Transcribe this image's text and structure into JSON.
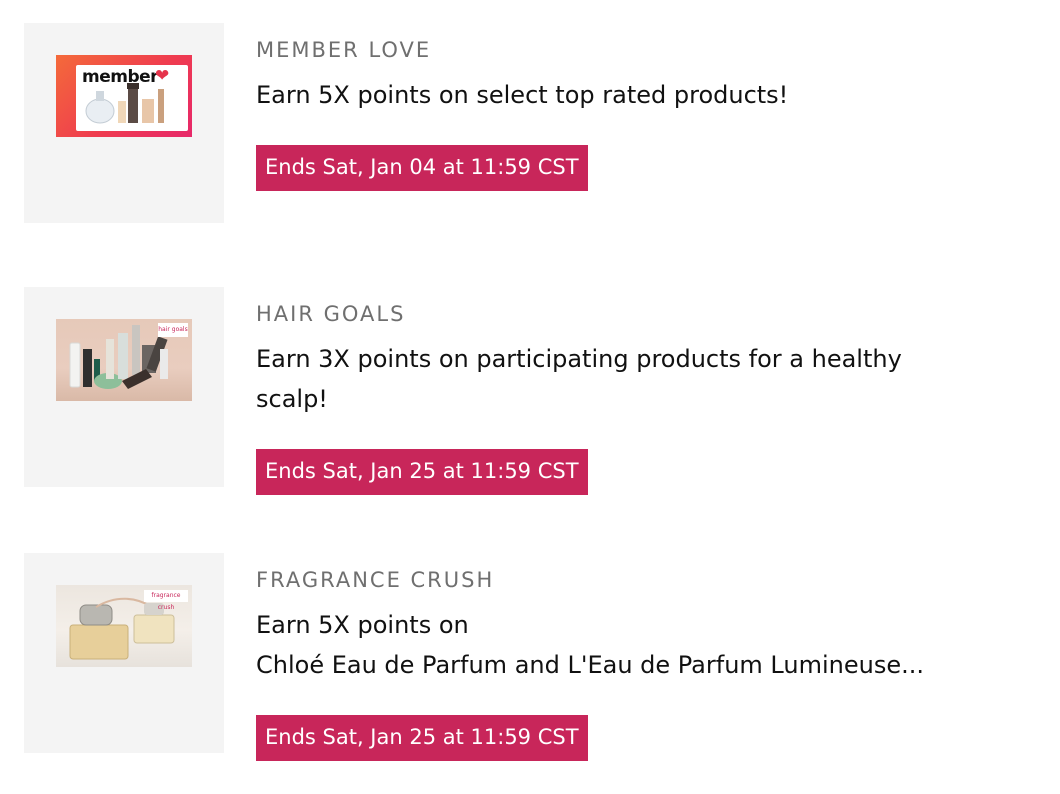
{
  "offers": [
    {
      "category": "MEMBER LOVE",
      "description_lines": [
        "Earn 5X points on select top rated products!"
      ],
      "end_badge": "Ends Sat, Jan 04 at 11:59 CST",
      "thumbnail": {
        "wordmark": "member",
        "icon": "heart-icon"
      }
    },
    {
      "category": "HAIR GOALS",
      "description_lines": [
        "Earn 3X points on participating products for a healthy",
        "scalp!"
      ],
      "end_badge": "Ends Sat, Jan 25 at 11:59 CST",
      "thumbnail": {
        "tag": "hair goals"
      }
    },
    {
      "category": "FRAGRANCE CRUSH",
      "description_lines": [
        "Earn 5X points on",
        "Chloé Eau de Parfum and L'Eau de Parfum Lumineuse..."
      ],
      "end_badge": "Ends Sat, Jan 25 at 11:59 CST",
      "thumbnail": {
        "tag": "fragrance crush"
      }
    }
  ],
  "colors": {
    "badge_bg": "#c8265a",
    "badge_text": "#ffffff",
    "thumb_box_bg": "#f4f4f4",
    "category_text": "#6f6f6f"
  }
}
